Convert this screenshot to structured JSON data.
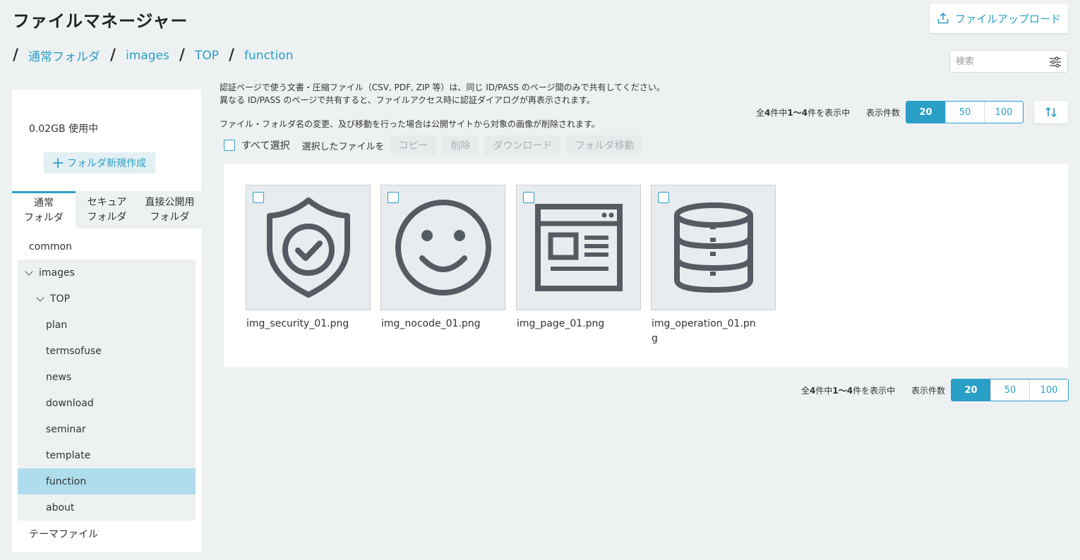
{
  "header": {
    "title": "ファイルマネージャー",
    "upload_label": "ファイルアップロード"
  },
  "breadcrumb": [
    "通常フォルダ",
    "images",
    "TOP",
    "function"
  ],
  "search": {
    "placeholder": "検索"
  },
  "sidebar": {
    "storage": "0.02GB 使用中",
    "new_folder_label": "フォルダ新規作成",
    "tabs": [
      {
        "line1": "通常",
        "line2": "フォルダ",
        "active": true
      },
      {
        "line1": "セキュア",
        "line2": "フォルダ",
        "active": false
      },
      {
        "line1": "直接公開用",
        "line2": "フォルダ",
        "active": false
      }
    ],
    "tree": [
      {
        "label": "common"
      },
      {
        "label": "images",
        "expanded": true
      },
      {
        "label": "TOP",
        "expanded": true
      },
      {
        "label": "plan"
      },
      {
        "label": "termsofuse"
      },
      {
        "label": "news"
      },
      {
        "label": "download"
      },
      {
        "label": "seminar"
      },
      {
        "label": "template"
      },
      {
        "label": "function",
        "selected": true
      },
      {
        "label": "about"
      },
      {
        "label": "テーマファイル"
      }
    ]
  },
  "notes": {
    "line1": "認証ページで使う文書・圧縮ファイル（CSV, PDF, ZIP 等）は、同じ ID/PASS のページ間のみで共有してください。",
    "line2": "異なる ID/PASS のページで共有すると、ファイルアクセス時に認証ダイアログが再表示されます。",
    "line3": "ファイル・フォルダ名の変更、及び移動を行った場合は公開サイトから対象の画像が削除されます。"
  },
  "pagination": {
    "info_prefix": "全",
    "total": "4",
    "info_mid": "件中",
    "range": "1〜4",
    "info_suffix": "件を表示中",
    "per_page_label": "表示件数",
    "options": [
      "20",
      "50",
      "100"
    ],
    "selected": "20"
  },
  "actions": {
    "select_all": "すべて選択",
    "selected_files": "選択したファイルを",
    "copy": "コピー",
    "delete": "削除",
    "download": "ダウンロード",
    "move": "フォルダ移動"
  },
  "files": [
    {
      "name": "img_security_01.png",
      "icon": "shield-check-icon"
    },
    {
      "name": "img_nocode_01.png",
      "icon": "smiley-icon"
    },
    {
      "name": "img_page_01.png",
      "icon": "browser-page-icon"
    },
    {
      "name": "img_operation_01.png",
      "icon": "database-icon"
    }
  ],
  "colors": {
    "accent": "#2a9fc7",
    "background": "#eef1f2",
    "selected_node": "#b0ddee"
  }
}
